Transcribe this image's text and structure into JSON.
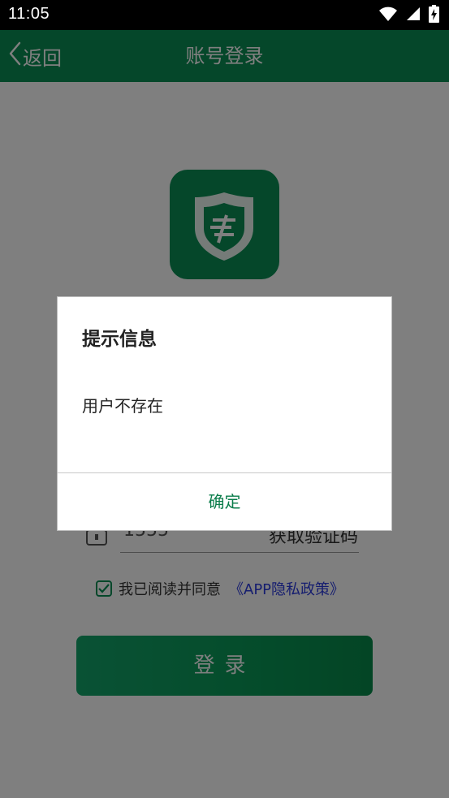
{
  "status_bar": {
    "time": "11:05",
    "icons": [
      "wifi-icon",
      "signal-icon",
      "battery-icon"
    ]
  },
  "nav": {
    "back_label": "返回",
    "title": "账号登录"
  },
  "form": {
    "phone_value": "1555",
    "get_code_label": "获取验证码",
    "agree_text": "我已阅读并同意",
    "policy_link": "《APP隐私政策》",
    "agree_checked": true,
    "login_label": "登录"
  },
  "dialog": {
    "title": "提示信息",
    "message": "用户不存在",
    "confirm_label": "确定"
  },
  "colors": {
    "brand_green": "#0b8f55",
    "link_blue": "#2a3adf",
    "status_bar": "#000000"
  }
}
